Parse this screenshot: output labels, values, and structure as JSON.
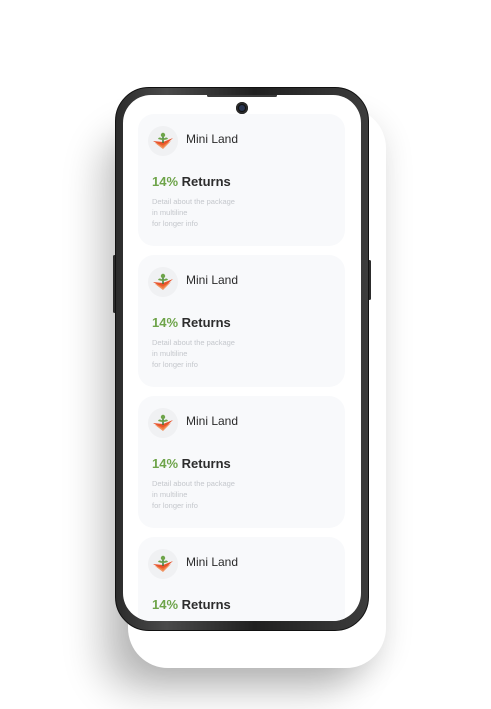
{
  "cards": [
    {
      "title": "Mini Land",
      "percent": "14%",
      "label": "Returns",
      "desc1": "Detail about the package",
      "desc2": "in multiline",
      "desc3": "for longer info"
    },
    {
      "title": "Mini Land",
      "percent": "14%",
      "label": "Returns",
      "desc1": "Detail about the package",
      "desc2": "in multiline",
      "desc3": "for longer info"
    },
    {
      "title": "Mini Land",
      "percent": "14%",
      "label": "Returns",
      "desc1": "Detail about the package",
      "desc2": "in multiline",
      "desc3": "for longer info"
    },
    {
      "title": "Mini Land",
      "percent": "14%",
      "label": "Returns"
    }
  ],
  "colors": {
    "accent": "#6ea44a",
    "logo_orange": "#e8542c",
    "card_bg": "#f8f9fb"
  },
  "icons": {
    "logo": "land-plant-icon"
  }
}
